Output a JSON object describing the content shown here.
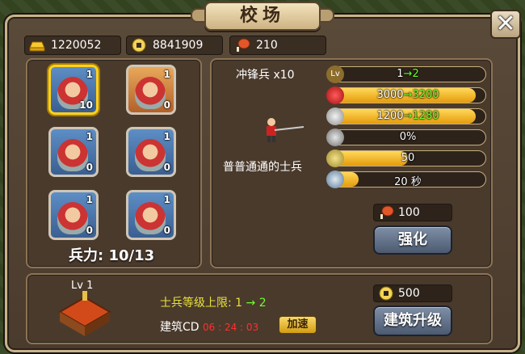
{
  "title": "校场",
  "close_label": "✕",
  "resources": {
    "gold_ingots": "1220052",
    "coins": "8841909",
    "food": "210"
  },
  "units": [
    {
      "top": "1",
      "bottom": "10",
      "selected": true
    },
    {
      "top": "1",
      "bottom": "0",
      "selected": false
    },
    {
      "top": "1",
      "bottom": "0",
      "selected": false
    },
    {
      "top": "1",
      "bottom": "0",
      "selected": false
    },
    {
      "top": "1",
      "bottom": "0",
      "selected": false
    },
    {
      "top": "1",
      "bottom": "0",
      "selected": false
    }
  ],
  "strength": {
    "label": "兵力",
    "value": "10/13",
    "text": "兵力: 10/13"
  },
  "detail": {
    "name": "冲锋兵 x10",
    "description": "普普通通的士兵",
    "stats": {
      "level": {
        "icon": "level-icon",
        "label": "Lv",
        "from": "1",
        "to": "2",
        "fill": 0.06
      },
      "hp": {
        "icon": "heart-icon",
        "from": "3000",
        "to": "3200",
        "fill": 0.94
      },
      "attack": {
        "icon": "sword-icon",
        "from": "1200",
        "to": "1280",
        "fill": 0.94
      },
      "defense": {
        "icon": "shield-icon",
        "value": "0%",
        "fill": 0.0
      },
      "food_cost": {
        "icon": "food-icon",
        "value": "50",
        "fill": 0.5
      },
      "time": {
        "icon": "hourglass-icon",
        "value": "20 秒",
        "fill": 0.18
      }
    },
    "upgrade_cost": "100",
    "upgrade_button": "强化"
  },
  "building": {
    "level": "Lv 1",
    "cap_label": "士兵等级上限: 1",
    "cap_arrow": "→",
    "cap_next": "2",
    "cd_label": "建筑CD",
    "cd_time": "06 : 24 : 03",
    "speed_button": "加速",
    "cost": "500",
    "upgrade_button": "建筑升级"
  },
  "colors": {
    "accent_green": "#6dff2f",
    "bar_gold": "#e59b0c",
    "cd_red": "#ff2f2f",
    "cap_yellow": "#e8e23b"
  }
}
